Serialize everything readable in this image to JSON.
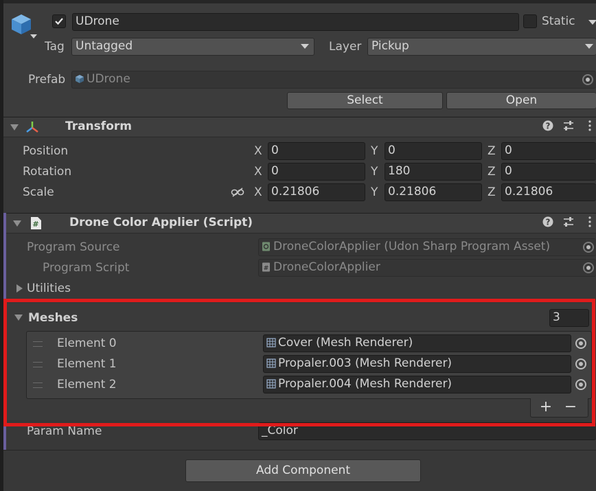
{
  "gameobject": {
    "name": "UDrone",
    "static_label": "Static",
    "tag_label": "Tag",
    "tag_value": "Untagged",
    "layer_label": "Layer",
    "layer_value": "Pickup",
    "prefab_label": "Prefab",
    "prefab_value": "UDrone",
    "select_button": "Select",
    "open_button": "Open"
  },
  "transform": {
    "title": "Transform",
    "position_label": "Position",
    "rotation_label": "Rotation",
    "scale_label": "Scale",
    "axis_x": "X",
    "axis_y": "Y",
    "axis_z": "Z",
    "position": {
      "x": "0",
      "y": "0",
      "z": "0"
    },
    "rotation": {
      "x": "0",
      "y": "180",
      "z": "0"
    },
    "scale": {
      "x": "0.21806",
      "y": "0.21806",
      "z": "0.21806"
    }
  },
  "script": {
    "title": "Drone Color Applier (Script)",
    "program_source_label": "Program Source",
    "program_source_value": "DroneColorApplier (Udon Sharp Program Asset)",
    "program_script_label": "Program Script",
    "program_script_value": "DroneColorApplier",
    "utilities_label": "Utilities",
    "meshes_label": "Meshes",
    "meshes_count": "3",
    "elements": [
      {
        "label": "Element 0",
        "value": "Cover (Mesh Renderer)"
      },
      {
        "label": "Element 1",
        "value": "Propaler.003 (Mesh Renderer)"
      },
      {
        "label": "Element 2",
        "value": "Propaler.004 (Mesh Renderer)"
      }
    ],
    "add_symbol": "+",
    "remove_symbol": "−",
    "param_name_label": "Param Name",
    "param_name_value": "_Color"
  },
  "add_component_button": "Add Component",
  "colors": {
    "highlight": "#e01b1b",
    "script_accent": "#6a5f9e"
  },
  "icons": [
    "gameobject-cube-icon",
    "checkbox-check-icon",
    "transform-axis-icon",
    "help-icon",
    "settings-sliders-icon",
    "kebab-menu-icon",
    "csharp-script-icon",
    "link-scale-icon",
    "mesh-renderer-icon",
    "object-picker-icon",
    "drag-handle-icon"
  ]
}
